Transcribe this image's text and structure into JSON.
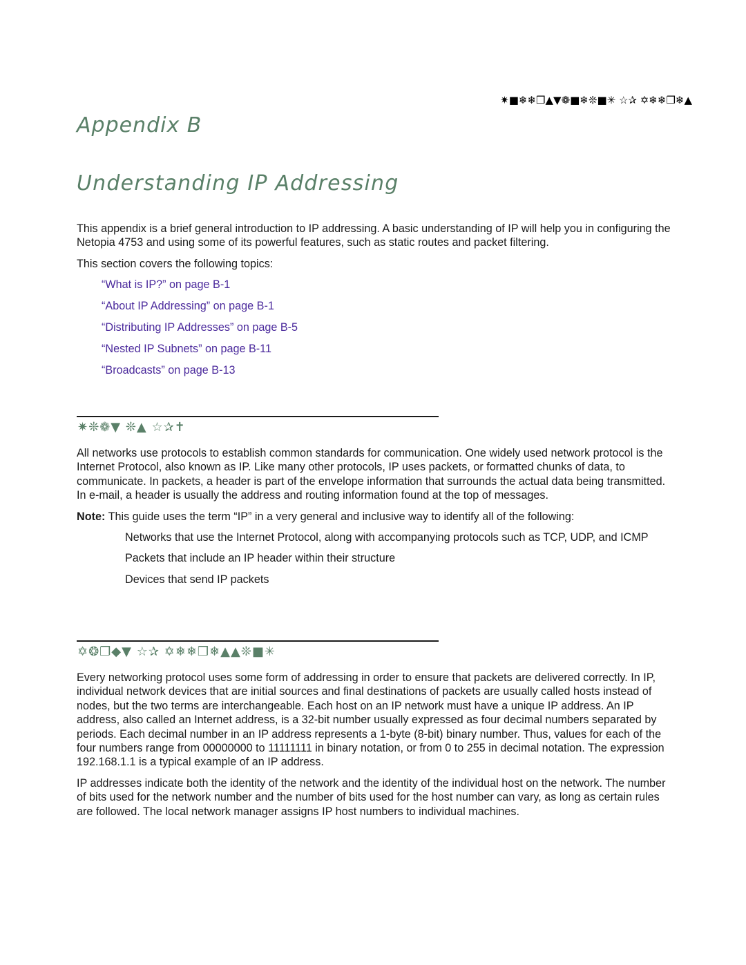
{
  "running_head": "✷■❄❄❒▲▼❁■❄❊■✳ ☆✰ ✡❄❄❒❄▲",
  "chapter_label": "Appendix B",
  "chapter_title": "Understanding IP Addressing",
  "intro": {
    "paragraph": "This appendix is a brief general introduction to IP addressing. A basic understanding of IP will help you in configuring the Netopia 4753 and using some of its powerful features, such as static routes and packet filtering.",
    "topics_lead": "This section covers the following topics:",
    "topics": [
      "“What is IP?” on page B-1",
      "“About IP Addressing” on page B-1",
      "“Distributing IP Addresses” on page B-5",
      "“Nested IP Subnets” on page B-11",
      "“Broadcasts” on page B-13"
    ]
  },
  "section_what_is_ip": {
    "heading": "✷❊❁▼ ❊▲ ☆✰✝",
    "paragraph": "All networks use protocols to establish common standards for communication. One widely used network protocol is the Internet Protocol, also known as IP. Like many other protocols, IP uses packets, or formatted chunks of data, to communicate. In packets, a header is part of the envelope information that surrounds the actual data being transmitted. In e-mail, a header is usually the address and routing information found at the top of messages.",
    "note_label": "Note:",
    "note_text": "This guide uses the term “IP” in a very general and inclusive way to identify all of the following:",
    "items": [
      "Networks that use the Internet Protocol, along with accompanying protocols such as TCP, UDP, and ICMP",
      "Packets that include an IP header within their structure",
      "Devices that send IP packets"
    ]
  },
  "section_about_ip": {
    "heading": "✡❂❐◆▼ ☆✰ ✡❄❄❒❄▲▲❊■✳",
    "paragraphs": [
      "Every networking protocol uses some form of addressing in order to ensure that packets are delivered correctly. In IP, individual network devices that are initial sources and final destinations of packets are usually called hosts instead of nodes, but the two terms are interchangeable. Each host on an IP network must have a unique IP address. An IP address, also called an Internet address, is a 32-bit number usually expressed as four decimal numbers separated by periods. Each decimal number in an IP address represents a 1-byte (8-bit) binary number. Thus, values for each of the four numbers range from 00000000 to 11111111 in binary notation, or from 0 to 255 in decimal notation. The expression 192.168.1.1 is a typical example of an IP address.",
      "IP addresses indicate both the identity of the network and the identity of the individual host on the network. The number of bits used for the network number and the number of bits used for the host number can vary, as long as certain rules are followed. The local network manager assigns IP host numbers to individual machines."
    ]
  }
}
